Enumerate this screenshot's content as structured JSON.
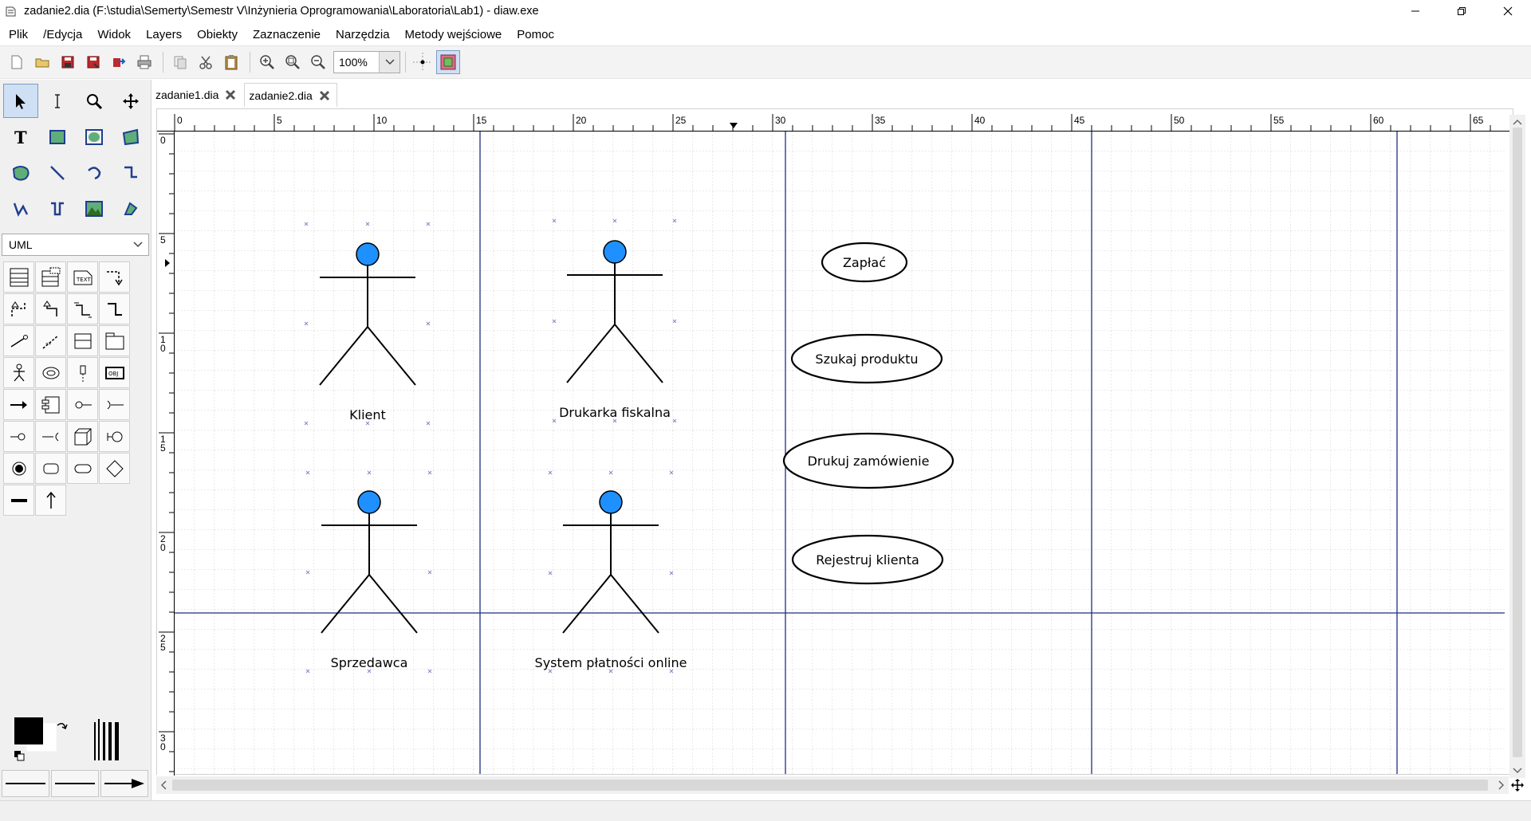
{
  "window": {
    "title": "zadanie2.dia (F:\\studia\\Semerty\\Semestr V\\Inżynieria Oprogramowania\\Laboratoria\\Lab1) - diaw.exe"
  },
  "menu": {
    "items": [
      "Plik",
      "/Edycja",
      "Widok",
      "Layers",
      "Obiekty",
      "Zaznaczenie",
      "Narzędzia",
      "Metody wejściowe",
      "Pomoc"
    ]
  },
  "toolbar": {
    "zoom_value": "100%"
  },
  "toolbox": {
    "sheet_name": "UML"
  },
  "tabs": [
    {
      "label": "zadanie1.dia",
      "active": false
    },
    {
      "label": "zadanie2.dia",
      "active": true
    }
  ],
  "ruler": {
    "h_labels": [
      "0",
      "5",
      "10",
      "15",
      "20",
      "25",
      "30",
      "35",
      "40",
      "45",
      "50",
      "55",
      "60",
      "65"
    ],
    "v_labels": [
      "0",
      "5",
      "10",
      "15",
      "20",
      "25",
      "30"
    ]
  },
  "diagram": {
    "actors": [
      {
        "name": "Klient"
      },
      {
        "name": "Drukarka fiskalna"
      },
      {
        "name": "Sprzedawca"
      },
      {
        "name": "System płatności online"
      }
    ],
    "use_cases": [
      {
        "name": "Zapłać"
      },
      {
        "name": "Szukaj produktu"
      },
      {
        "name": "Drukuj zamówienie"
      },
      {
        "name": "Rejestruj klienta"
      }
    ],
    "actor_color": "#1e90ff",
    "page_break_color": "#1f2f7f"
  }
}
